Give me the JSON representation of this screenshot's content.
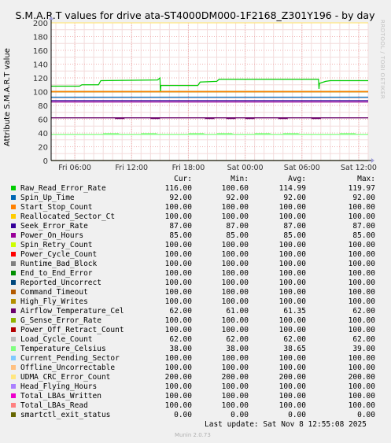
{
  "chart_data": {
    "type": "line",
    "title": "S.M.A.R.T values for drive ata-ST4000DM000-1F2168_Z301Y196 - by day",
    "ylabel": "Attribute S.M.A.R.T value",
    "ylim": [
      0,
      200
    ],
    "yticks": [
      0,
      20,
      40,
      60,
      80,
      100,
      120,
      140,
      160,
      180,
      200
    ],
    "xlim": [
      "Fri 03:30",
      "Sat 13:00"
    ],
    "xticks": [
      "Fri 06:00",
      "Fri 12:00",
      "Fri 18:00",
      "Sat 00:00",
      "Sat 06:00",
      "Sat 12:00"
    ],
    "columns": [
      "Cur:",
      "Min:",
      "Avg:",
      "Max:"
    ],
    "series": [
      {
        "name": "Raw_Read_Error_Rate",
        "color": "#00cc00",
        "cur": "116.00",
        "min": "100.60",
        "avg": "114.99",
        "max": "119.97"
      },
      {
        "name": "Spin_Up_Time",
        "color": "#0066b3",
        "cur": "92.00",
        "min": "92.00",
        "avg": "92.00",
        "max": "92.00"
      },
      {
        "name": "Start_Stop_Count",
        "color": "#ff8000",
        "cur": "100.00",
        "min": "100.00",
        "avg": "100.00",
        "max": "100.00"
      },
      {
        "name": "Reallocated_Sector_Ct",
        "color": "#ffcc00",
        "cur": "100.00",
        "min": "100.00",
        "avg": "100.00",
        "max": "100.00"
      },
      {
        "name": "Seek_Error_Rate",
        "color": "#330099",
        "cur": "87.00",
        "min": "87.00",
        "avg": "87.00",
        "max": "87.00"
      },
      {
        "name": "Power_On_Hours",
        "color": "#990099",
        "cur": "85.00",
        "min": "85.00",
        "avg": "85.00",
        "max": "85.00"
      },
      {
        "name": "Spin_Retry_Count",
        "color": "#ccff00",
        "cur": "100.00",
        "min": "100.00",
        "avg": "100.00",
        "max": "100.00"
      },
      {
        "name": "Power_Cycle_Count",
        "color": "#ff0000",
        "cur": "100.00",
        "min": "100.00",
        "avg": "100.00",
        "max": "100.00"
      },
      {
        "name": "Runtime_Bad_Block",
        "color": "#808080",
        "cur": "100.00",
        "min": "100.00",
        "avg": "100.00",
        "max": "100.00"
      },
      {
        "name": "End_to_End_Error",
        "color": "#008f00",
        "cur": "100.00",
        "min": "100.00",
        "avg": "100.00",
        "max": "100.00"
      },
      {
        "name": "Reported_Uncorrect",
        "color": "#00487d",
        "cur": "100.00",
        "min": "100.00",
        "avg": "100.00",
        "max": "100.00"
      },
      {
        "name": "Command_Timeout",
        "color": "#b35a00",
        "cur": "100.00",
        "min": "100.00",
        "avg": "100.00",
        "max": "100.00"
      },
      {
        "name": "High_Fly_Writes",
        "color": "#b38f00",
        "cur": "100.00",
        "min": "100.00",
        "avg": "100.00",
        "max": "100.00"
      },
      {
        "name": "Airflow_Temperature_Cel",
        "color": "#6b006b",
        "cur": "62.00",
        "min": "61.00",
        "avg": "61.35",
        "max": "62.00"
      },
      {
        "name": "G_Sense_Error_Rate",
        "color": "#8fb300",
        "cur": "100.00",
        "min": "100.00",
        "avg": "100.00",
        "max": "100.00"
      },
      {
        "name": "Power_Off_Retract_Count",
        "color": "#b30000",
        "cur": "100.00",
        "min": "100.00",
        "avg": "100.00",
        "max": "100.00"
      },
      {
        "name": "Load_Cycle_Count",
        "color": "#bebebe",
        "cur": "62.00",
        "min": "62.00",
        "avg": "62.00",
        "max": "62.00"
      },
      {
        "name": "Temperature_Celsius",
        "color": "#80ff80",
        "cur": "38.00",
        "min": "38.00",
        "avg": "38.65",
        "max": "39.00"
      },
      {
        "name": "Current_Pending_Sector",
        "color": "#80c9ff",
        "cur": "100.00",
        "min": "100.00",
        "avg": "100.00",
        "max": "100.00"
      },
      {
        "name": "Offline_Uncorrectable",
        "color": "#ffc080",
        "cur": "100.00",
        "min": "100.00",
        "avg": "100.00",
        "max": "100.00"
      },
      {
        "name": "UDMA_CRC_Error_Count",
        "color": "#ffe680",
        "cur": "200.00",
        "min": "200.00",
        "avg": "200.00",
        "max": "200.00"
      },
      {
        "name": "Head_Flying_Hours",
        "color": "#aa80ff",
        "cur": "100.00",
        "min": "100.00",
        "avg": "100.00",
        "max": "100.00"
      },
      {
        "name": "Total_LBAs_Written",
        "color": "#ee00cc",
        "cur": "100.00",
        "min": "100.00",
        "avg": "100.00",
        "max": "100.00"
      },
      {
        "name": "Total_LBAs_Read",
        "color": "#ff8080",
        "cur": "100.00",
        "min": "100.00",
        "avg": "100.00",
        "max": "100.00"
      },
      {
        "name": "smartctl_exit_status",
        "color": "#666600",
        "cur": "0.00",
        "min": "0.00",
        "avg": "0.00",
        "max": "0.00"
      }
    ],
    "raw_read_error_rate_trace": {
      "x": [
        "Fri 03:30",
        "Fri 06:30",
        "Fri 06:45",
        "Fri 08:30",
        "Fri 08:45",
        "Fri 14:45",
        "Fri 15:00",
        "Fri 15:03",
        "Fri 15:06",
        "Fri 19:00",
        "Fri 19:15",
        "Fri 21:00",
        "Fri 21:15",
        "Sat 07:45",
        "Sat 07:48",
        "Sat 07:51",
        "Sat 08:30",
        "Sat 09:00",
        "Sat 13:00"
      ],
      "y": [
        108,
        108,
        110,
        110,
        116,
        117,
        120,
        100.6,
        109,
        109,
        114,
        115,
        118,
        118,
        104,
        112,
        115,
        116,
        116
      ]
    },
    "airflow_temperature_dips": [
      "Fri 10:15",
      "Fri 14:00",
      "Fri 19:45",
      "Fri 22:00",
      "Sat 00:00",
      "Sat 03:30",
      "Sat 07:00"
    ],
    "temperature_celsius_dips": [
      "Fri 09:00",
      "Fri 13:00",
      "Fri 18:00",
      "Fri 21:00",
      "Sat 01:00",
      "Sat 04:00",
      "Sat 10:00"
    ]
  },
  "legend_header": {
    "cur": "Cur:",
    "min": "Min:",
    "avg": "Avg:",
    "max": "Max:"
  },
  "footer": {
    "last_update": "Last update: Sat Nov  8 12:55:08 2025",
    "munin_version": "Munin 2.0.73",
    "side_label": "RRDTOOL / TOBI OETIKER"
  }
}
